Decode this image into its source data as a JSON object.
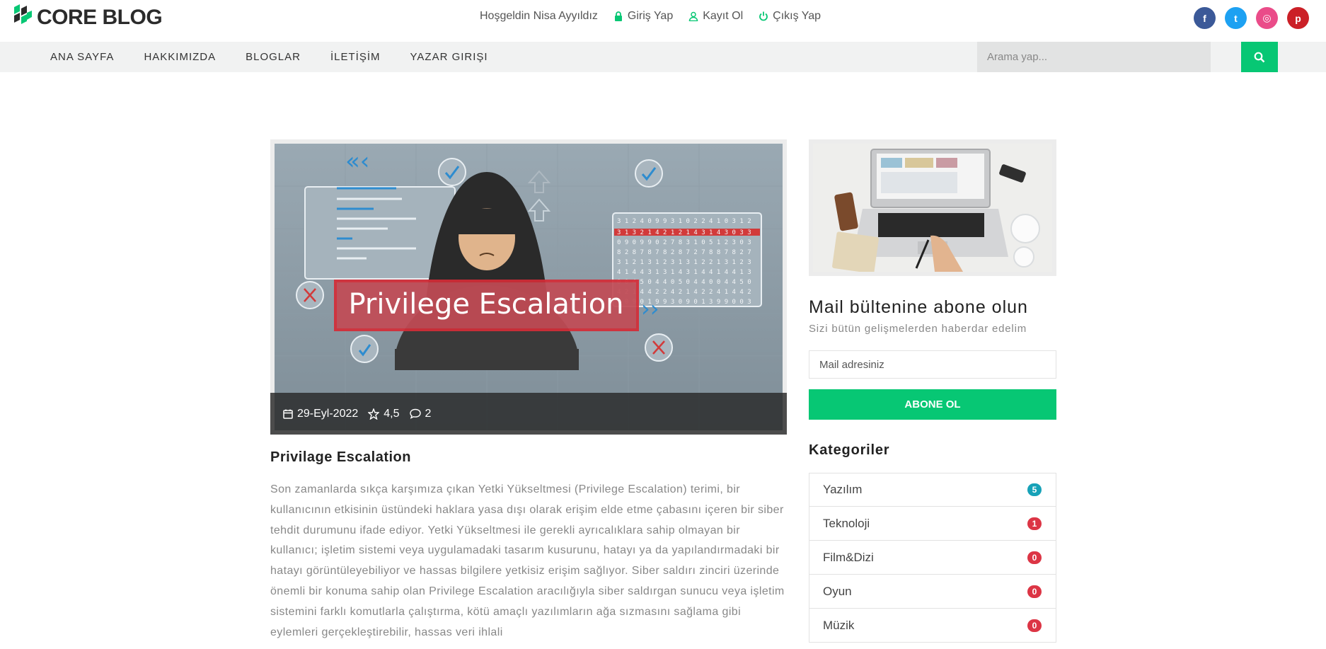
{
  "brand": {
    "name": "CORE BLOG"
  },
  "user_bar": {
    "welcome": "Hoşgeldin Nisa Ayyıldız",
    "login": "Giriş Yap",
    "register": "Kayıt Ol",
    "logout": "Çıkış Yap"
  },
  "socials": [
    {
      "icon": "facebook-icon",
      "glyph": "f",
      "color": "#3b5998"
    },
    {
      "icon": "twitter-icon",
      "glyph": "t",
      "color": "#1da1f2"
    },
    {
      "icon": "dribbble-icon",
      "glyph": "◎",
      "color": "#ea4c89"
    },
    {
      "icon": "pinterest-icon",
      "glyph": "p",
      "color": "#cb2027"
    }
  ],
  "nav": {
    "items": [
      "ANA SAYFA",
      "HAKKIMIZDA",
      "BLOGLAR",
      "İLETİŞİM",
      "YAZAR GIRIŞI"
    ],
    "search_placeholder": "Arama yap..."
  },
  "post": {
    "image_caption": "Privilege Escalation",
    "date": "29-Eyl-2022",
    "rating": "4,5",
    "comments": "2",
    "title": "Privilage Escalation",
    "body": "Son zamanlarda sıkça karşımıza çıkan Yetki Yükseltmesi (Privilege Escalation) terimi, bir kullanıcının etkisinin üstündeki haklara yasa dışı olarak erişim elde etme çabasını içeren bir siber tehdit durumunu ifade ediyor. Yetki Yükseltmesi ile gerekli ayrıcalıklara sahip olmayan bir kullanıcı; işletim sistemi veya uygulamadaki tasarım kusurunu, hatayı ya da yapılandırmadaki bir hatayı görüntüleyebiliyor ve hassas bilgilere yetkisiz erişim sağlıyor. Siber saldırı zinciri üzerinde önemli bir konuma sahip olan Privilege Escalation aracılığıyla siber saldırgan sunucu veya işletim sistemini farklı komutlarla çalıştırma, kötü amaçlı yazılımların ağa sızmasını sağlama gibi eylemleri gerçekleştirebilir, hassas veri ihlali"
  },
  "newsletter": {
    "title": "Mail bültenine abone olun",
    "subtitle": "Sizi bütün gelişmelerden haberdar edelim",
    "placeholder": "Mail adresiniz",
    "button": "ABONE OL"
  },
  "categories": {
    "title": "Kategoriler",
    "items": [
      {
        "name": "Yazılım",
        "count": "5",
        "color": "#17a2b8"
      },
      {
        "name": "Teknoloji",
        "count": "1",
        "color": "#dc3545"
      },
      {
        "name": "Film&Dizi",
        "count": "0",
        "color": "#dc3545"
      },
      {
        "name": "Oyun",
        "count": "0",
        "color": "#dc3545"
      },
      {
        "name": "Müzik",
        "count": "0",
        "color": "#dc3545"
      }
    ]
  },
  "colors": {
    "accent": "#07c774",
    "text_dark": "#222222",
    "text_muted": "#888888"
  }
}
